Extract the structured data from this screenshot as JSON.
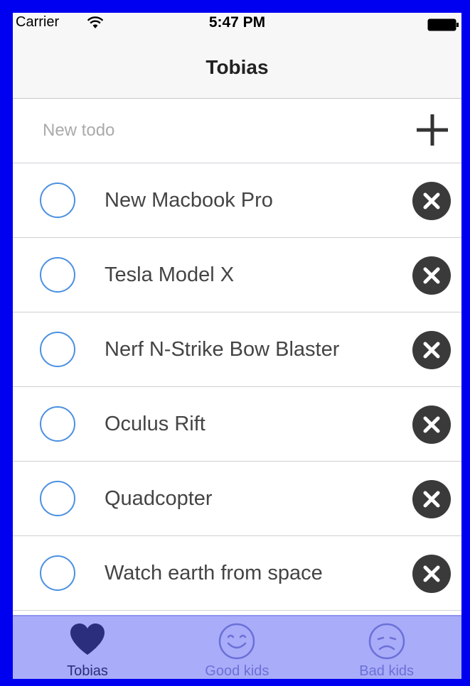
{
  "status_bar": {
    "carrier": "Carrier",
    "time": "5:47 PM"
  },
  "nav": {
    "title": "Tobias"
  },
  "new_todo": {
    "placeholder": "New todo",
    "value": "",
    "add_icon": "plus-icon"
  },
  "todos": [
    {
      "label": "New Macbook Pro",
      "done": false
    },
    {
      "label": "Tesla Model X",
      "done": false
    },
    {
      "label": "Nerf N-Strike Bow Blaster",
      "done": false
    },
    {
      "label": "Oculus Rift",
      "done": false
    },
    {
      "label": "Quadcopter",
      "done": false
    },
    {
      "label": "Watch earth from space",
      "done": false
    }
  ],
  "tabs": [
    {
      "label": "Tobias",
      "icon": "heart-icon",
      "active": true
    },
    {
      "label": "Good kids",
      "icon": "smiley-happy-icon",
      "active": false
    },
    {
      "label": "Bad kids",
      "icon": "smiley-sad-icon",
      "active": false
    }
  ],
  "colors": {
    "accent": "#4a90e2",
    "delete": "#3a3a3a",
    "tab_bar": "#a9acf8",
    "tab_active": "#2a2e7c",
    "tab_inactive": "#6b70d8",
    "frame": "#0000f0"
  }
}
